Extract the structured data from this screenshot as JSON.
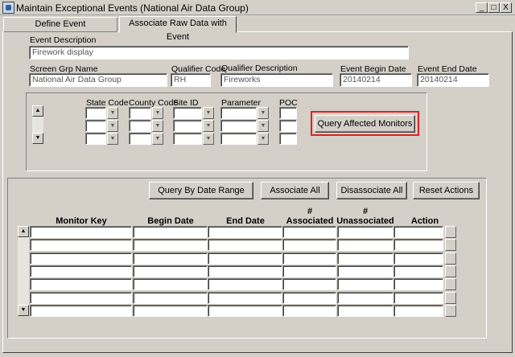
{
  "window": {
    "title": "Maintain Exceptional Events (National Air Data Group)",
    "btn_min": "_",
    "btn_max": "□",
    "btn_close": "X"
  },
  "tabs": [
    {
      "label": "Define Event"
    },
    {
      "label": "Associate Raw Data with Event"
    }
  ],
  "event": {
    "description_label": "Event Description",
    "description_value": "Firework display",
    "screen_grp_label": "Screen Grp Name",
    "screen_grp_value": "National Air Data Group",
    "qualifier_code_label": "Qualifier Code",
    "qualifier_code_value": "RH",
    "qualifier_desc_label": "Qualifier Description",
    "qualifier_desc_value": "Fireworks",
    "begin_date_label": "Event Begin Date",
    "begin_date_value": "20140214",
    "end_date_label": "Event End Date",
    "end_date_value": "20140214"
  },
  "monitor_filter": {
    "state_code_label": "State Code",
    "county_code_label": "County Code",
    "site_id_label": "Site ID",
    "parameter_label": "Parameter",
    "poc_label": "POC",
    "query_button": "Query Affected Monitors"
  },
  "actions": {
    "query_by_date": "Query By Date Range",
    "associate_all": "Associate All",
    "disassociate_all": "Disassociate All",
    "reset_actions": "Reset Actions"
  },
  "table": {
    "col_monitor_key": "Monitor Key",
    "col_begin_date": "Begin Date",
    "col_end_date": "End Date",
    "col_associated_1": "#",
    "col_associated_2": "Associated",
    "col_unassociated_1": "#",
    "col_unassociated_2": "Unassociated",
    "col_action": "Action"
  },
  "icons": {
    "scroll_up": "▲",
    "scroll_down": "▼",
    "dropdown": "▼"
  }
}
